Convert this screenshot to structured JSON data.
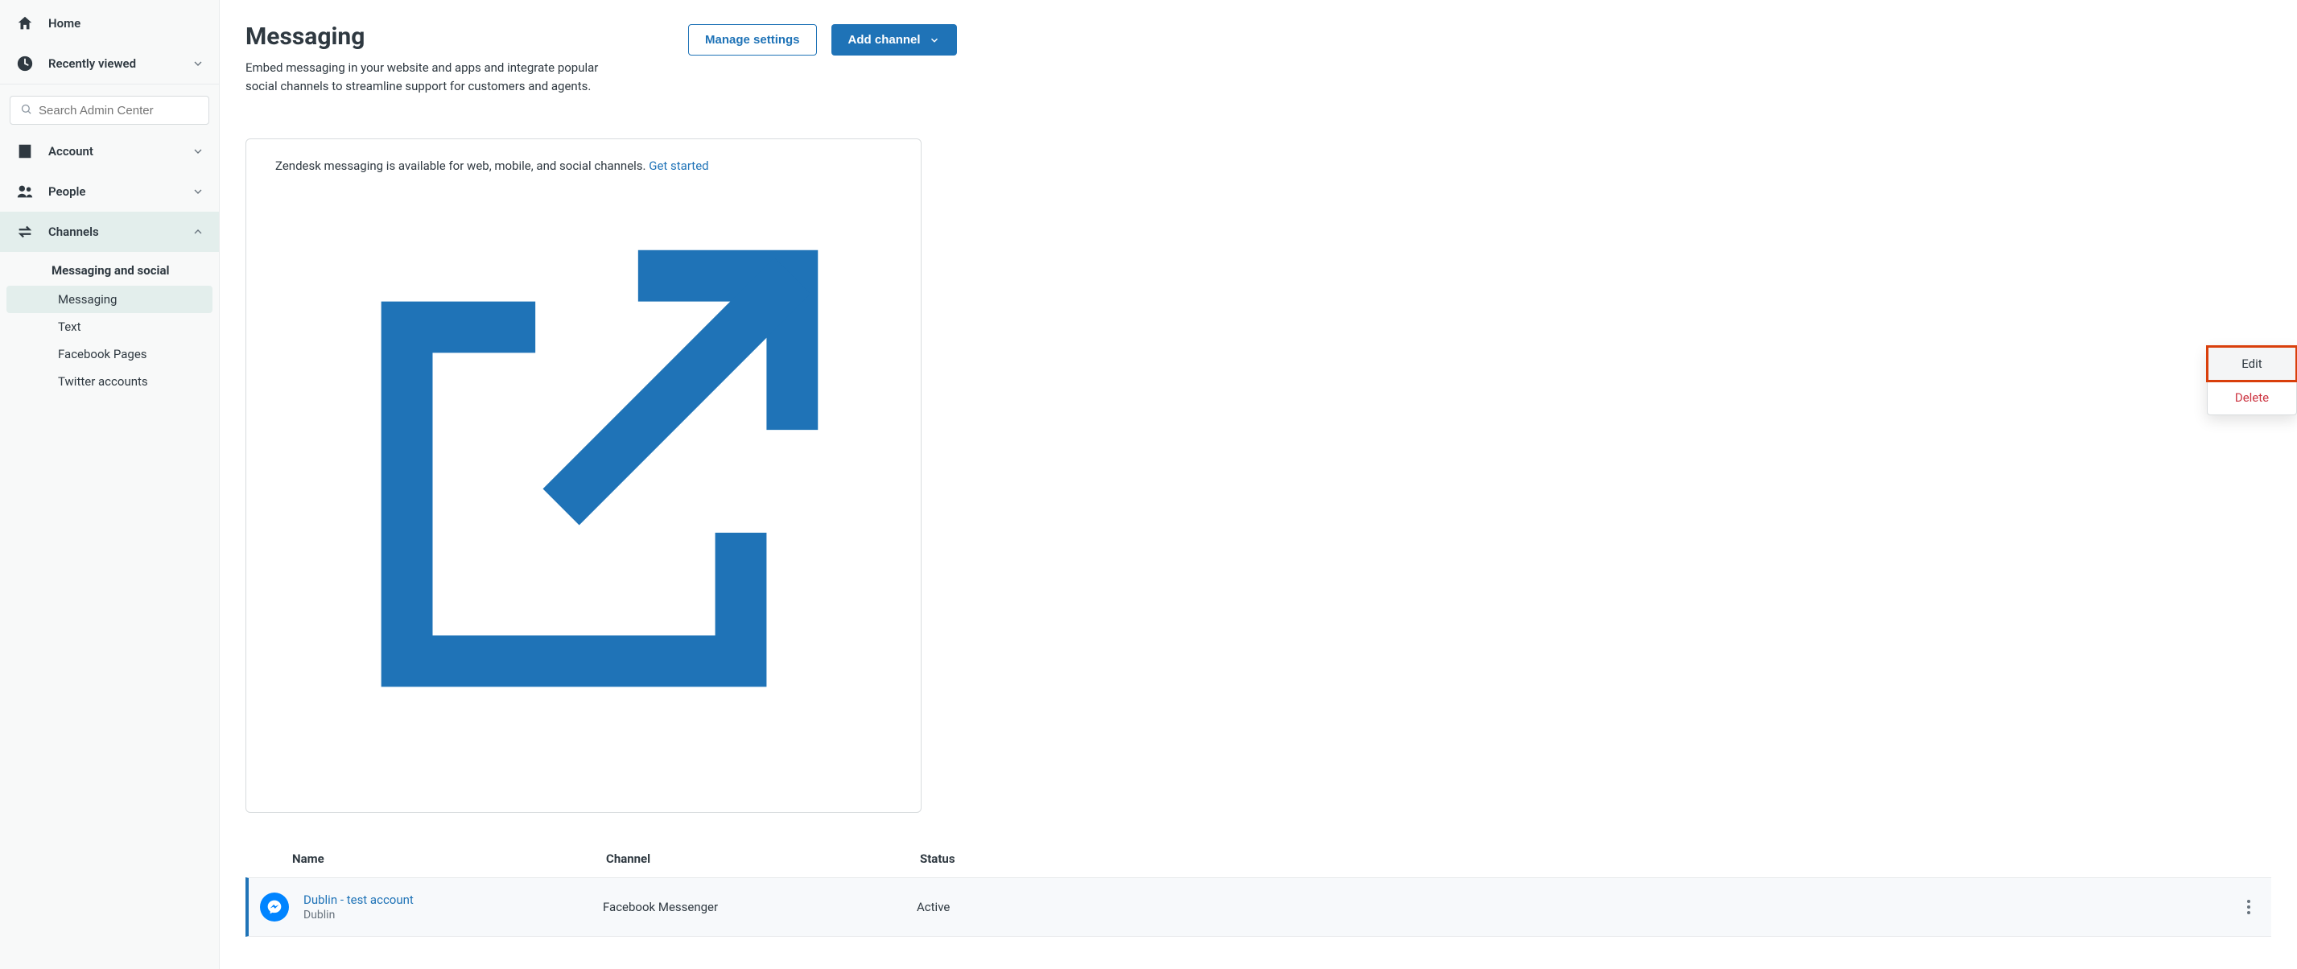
{
  "sidebar": {
    "search_placeholder": "Search Admin Center",
    "items": [
      {
        "label": "Home"
      },
      {
        "label": "Recently viewed"
      },
      {
        "label": "Account"
      },
      {
        "label": "People"
      },
      {
        "label": "Channels"
      }
    ],
    "sub_heading": "Messaging and social",
    "sub_items": [
      {
        "label": "Messaging"
      },
      {
        "label": "Text"
      },
      {
        "label": "Facebook Pages"
      },
      {
        "label": "Twitter accounts"
      }
    ]
  },
  "header": {
    "title": "Messaging",
    "description": "Embed messaging in your website and apps and integrate popular social channels to streamline support for customers and agents.",
    "manage_label": "Manage settings",
    "add_label": "Add channel"
  },
  "info": {
    "text": "Zendesk messaging is available for web, mobile, and social channels. ",
    "link_label": "Get started"
  },
  "table": {
    "col_name": "Name",
    "col_channel": "Channel",
    "col_status": "Status",
    "rows": [
      {
        "name": "Dublin - test account",
        "sub": "Dublin",
        "channel": "Facebook Messenger",
        "status": "Active"
      }
    ]
  },
  "menu": {
    "edit": "Edit",
    "delete": "Delete"
  }
}
